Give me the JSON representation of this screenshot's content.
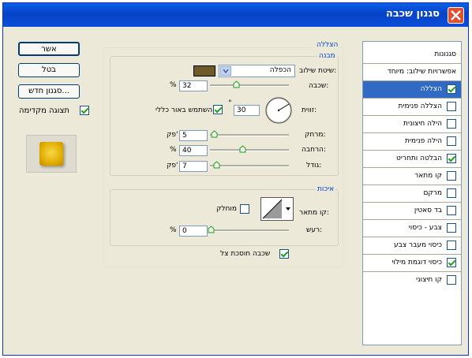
{
  "window": {
    "title": "סגנון שכבה"
  },
  "sidebar": {
    "header": "סגנונות",
    "items": [
      {
        "label": "אפשרויות שילוב: מיוחד",
        "checkbox": false,
        "selected": false
      },
      {
        "label": "הצללה",
        "checkbox": true,
        "checked": true,
        "selected": true
      },
      {
        "label": "הצללה פנימית",
        "checkbox": true,
        "checked": false
      },
      {
        "label": "הילה חיצונית",
        "checkbox": true,
        "checked": false
      },
      {
        "label": "הילה פנימית",
        "checkbox": true,
        "checked": false
      },
      {
        "label": "הבלטה ותחריט",
        "checkbox": true,
        "checked": true
      },
      {
        "label": "קו מתאר",
        "checkbox": true,
        "checked": false
      },
      {
        "label": "מרקם",
        "checkbox": true,
        "checked": false
      },
      {
        "label": "בד סאטין",
        "checkbox": true,
        "checked": false
      },
      {
        "label": "צבע - כיסוי",
        "checkbox": true,
        "checked": false
      },
      {
        "label": "כיסוי מעבר צבע",
        "checkbox": true,
        "checked": false
      },
      {
        "label": "כיסוי דוגמת מילוי",
        "checkbox": true,
        "checked": true
      },
      {
        "label": "קו חיצוני",
        "checkbox": true,
        "checked": false
      }
    ]
  },
  "shadow": {
    "section_label": "הצללה",
    "structure_label": "מבנה",
    "blend_mode_label": "שיטת שילוב:",
    "blend_mode_value": "הכפלה",
    "shadow_color": "#6e5a2a",
    "opacity_label": "שכבה:",
    "opacity_value": "32",
    "opacity_unit": "%",
    "opacity_level": 0.32,
    "angle_label": "זווית:",
    "angle_value": "30",
    "angle_unit": "°",
    "global_light_label": "השתמש באור כללי",
    "distance_label": "מרחק:",
    "distance_value": "5",
    "distance_unit": "פק'",
    "spread_label": "הרחבה:",
    "spread_value": "40",
    "spread_unit": "%",
    "size_label": "גודל:",
    "size_value": "7",
    "size_unit": "פק'",
    "quality_label": "איכות",
    "contour_label": "קו מתאר:",
    "antialias_label": "מוחלק",
    "noise_label": "רעש:",
    "noise_value": "0",
    "noise_unit": "%",
    "knockout_label": "שכבה חוסכת צל"
  },
  "buttons": {
    "ok": "אשר",
    "cancel": "בטל",
    "new_style": "סגנון חדש...",
    "preview_label": "תצוגה מקדימה"
  },
  "colors": {
    "titlebar": "#0842c8",
    "selection": "#316ac5",
    "dialog_bg": "#ece9d8",
    "preview_fill": "#e8b800"
  }
}
